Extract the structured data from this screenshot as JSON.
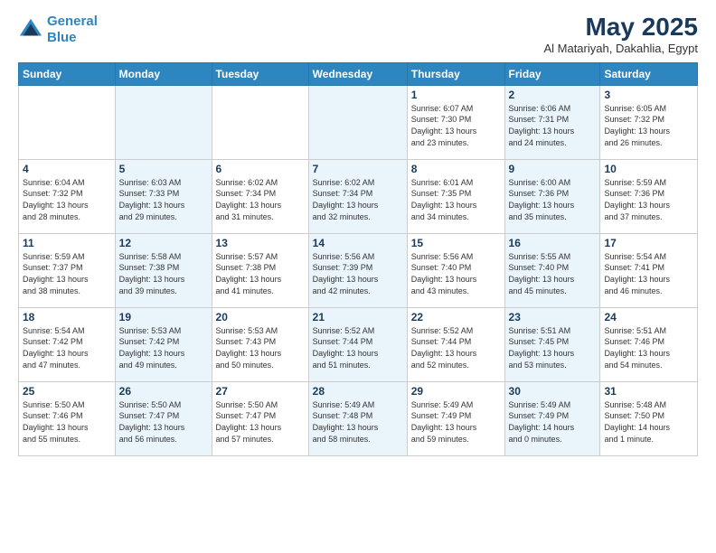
{
  "logo": {
    "line1": "General",
    "line2": "Blue"
  },
  "title": "May 2025",
  "subtitle": "Al Matariyah, Dakahlia, Egypt",
  "weekdays": [
    "Sunday",
    "Monday",
    "Tuesday",
    "Wednesday",
    "Thursday",
    "Friday",
    "Saturday"
  ],
  "weeks": [
    [
      {
        "day": "",
        "info": ""
      },
      {
        "day": "",
        "info": ""
      },
      {
        "day": "",
        "info": ""
      },
      {
        "day": "",
        "info": ""
      },
      {
        "day": "1",
        "info": "Sunrise: 6:07 AM\nSunset: 7:30 PM\nDaylight: 13 hours\nand 23 minutes."
      },
      {
        "day": "2",
        "info": "Sunrise: 6:06 AM\nSunset: 7:31 PM\nDaylight: 13 hours\nand 24 minutes."
      },
      {
        "day": "3",
        "info": "Sunrise: 6:05 AM\nSunset: 7:32 PM\nDaylight: 13 hours\nand 26 minutes."
      }
    ],
    [
      {
        "day": "4",
        "info": "Sunrise: 6:04 AM\nSunset: 7:32 PM\nDaylight: 13 hours\nand 28 minutes."
      },
      {
        "day": "5",
        "info": "Sunrise: 6:03 AM\nSunset: 7:33 PM\nDaylight: 13 hours\nand 29 minutes."
      },
      {
        "day": "6",
        "info": "Sunrise: 6:02 AM\nSunset: 7:34 PM\nDaylight: 13 hours\nand 31 minutes."
      },
      {
        "day": "7",
        "info": "Sunrise: 6:02 AM\nSunset: 7:34 PM\nDaylight: 13 hours\nand 32 minutes."
      },
      {
        "day": "8",
        "info": "Sunrise: 6:01 AM\nSunset: 7:35 PM\nDaylight: 13 hours\nand 34 minutes."
      },
      {
        "day": "9",
        "info": "Sunrise: 6:00 AM\nSunset: 7:36 PM\nDaylight: 13 hours\nand 35 minutes."
      },
      {
        "day": "10",
        "info": "Sunrise: 5:59 AM\nSunset: 7:36 PM\nDaylight: 13 hours\nand 37 minutes."
      }
    ],
    [
      {
        "day": "11",
        "info": "Sunrise: 5:59 AM\nSunset: 7:37 PM\nDaylight: 13 hours\nand 38 minutes."
      },
      {
        "day": "12",
        "info": "Sunrise: 5:58 AM\nSunset: 7:38 PM\nDaylight: 13 hours\nand 39 minutes."
      },
      {
        "day": "13",
        "info": "Sunrise: 5:57 AM\nSunset: 7:38 PM\nDaylight: 13 hours\nand 41 minutes."
      },
      {
        "day": "14",
        "info": "Sunrise: 5:56 AM\nSunset: 7:39 PM\nDaylight: 13 hours\nand 42 minutes."
      },
      {
        "day": "15",
        "info": "Sunrise: 5:56 AM\nSunset: 7:40 PM\nDaylight: 13 hours\nand 43 minutes."
      },
      {
        "day": "16",
        "info": "Sunrise: 5:55 AM\nSunset: 7:40 PM\nDaylight: 13 hours\nand 45 minutes."
      },
      {
        "day": "17",
        "info": "Sunrise: 5:54 AM\nSunset: 7:41 PM\nDaylight: 13 hours\nand 46 minutes."
      }
    ],
    [
      {
        "day": "18",
        "info": "Sunrise: 5:54 AM\nSunset: 7:42 PM\nDaylight: 13 hours\nand 47 minutes."
      },
      {
        "day": "19",
        "info": "Sunrise: 5:53 AM\nSunset: 7:42 PM\nDaylight: 13 hours\nand 49 minutes."
      },
      {
        "day": "20",
        "info": "Sunrise: 5:53 AM\nSunset: 7:43 PM\nDaylight: 13 hours\nand 50 minutes."
      },
      {
        "day": "21",
        "info": "Sunrise: 5:52 AM\nSunset: 7:44 PM\nDaylight: 13 hours\nand 51 minutes."
      },
      {
        "day": "22",
        "info": "Sunrise: 5:52 AM\nSunset: 7:44 PM\nDaylight: 13 hours\nand 52 minutes."
      },
      {
        "day": "23",
        "info": "Sunrise: 5:51 AM\nSunset: 7:45 PM\nDaylight: 13 hours\nand 53 minutes."
      },
      {
        "day": "24",
        "info": "Sunrise: 5:51 AM\nSunset: 7:46 PM\nDaylight: 13 hours\nand 54 minutes."
      }
    ],
    [
      {
        "day": "25",
        "info": "Sunrise: 5:50 AM\nSunset: 7:46 PM\nDaylight: 13 hours\nand 55 minutes."
      },
      {
        "day": "26",
        "info": "Sunrise: 5:50 AM\nSunset: 7:47 PM\nDaylight: 13 hours\nand 56 minutes."
      },
      {
        "day": "27",
        "info": "Sunrise: 5:50 AM\nSunset: 7:47 PM\nDaylight: 13 hours\nand 57 minutes."
      },
      {
        "day": "28",
        "info": "Sunrise: 5:49 AM\nSunset: 7:48 PM\nDaylight: 13 hours\nand 58 minutes."
      },
      {
        "day": "29",
        "info": "Sunrise: 5:49 AM\nSunset: 7:49 PM\nDaylight: 13 hours\nand 59 minutes."
      },
      {
        "day": "30",
        "info": "Sunrise: 5:49 AM\nSunset: 7:49 PM\nDaylight: 14 hours\nand 0 minutes."
      },
      {
        "day": "31",
        "info": "Sunrise: 5:48 AM\nSunset: 7:50 PM\nDaylight: 14 hours\nand 1 minute."
      }
    ]
  ]
}
